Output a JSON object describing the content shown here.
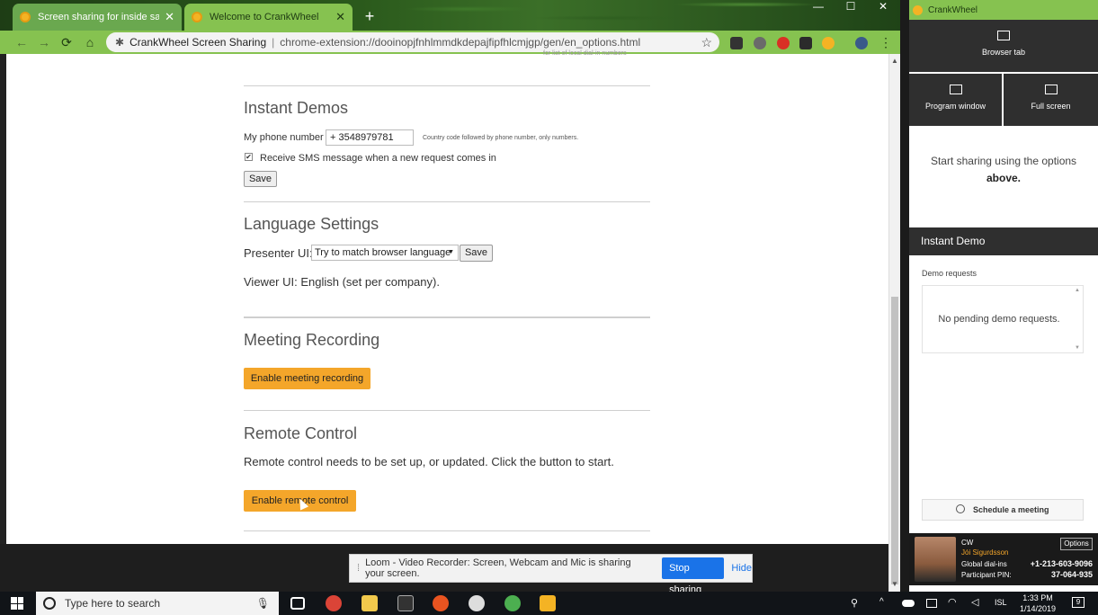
{
  "browser": {
    "tabs": [
      {
        "title": "Screen sharing for inside sales an",
        "close": "✕"
      },
      {
        "title": "Welcome to CrankWheel",
        "close": "✕"
      }
    ],
    "new_tab": "+",
    "window_controls": [
      "—",
      "☐",
      "✕"
    ],
    "nav": {
      "back": "←",
      "forward": "→",
      "reload": "⟳",
      "home": "⌂"
    },
    "omnibox": {
      "origin": "CrankWheel Screen Sharing",
      "separator": "|",
      "url": "chrome-extension://dooinopjfnhlmmdkdepajfipfhlcmjgp/gen/en_options.html",
      "star": "☆"
    },
    "menu": "⋮"
  },
  "page": {
    "top_fragment": "for list of local dial-in numbers",
    "instant_demos": {
      "title": "Instant Demos",
      "phone_label": "My phone number",
      "phone_value": "+  3548979781",
      "phone_hint": "Country code followed by phone number, only numbers.",
      "sms_label": "Receive SMS message when a new request comes in",
      "sms_checked": "✔",
      "save": "Save"
    },
    "language": {
      "title": "Language Settings",
      "presenter_label": "Presenter UI:",
      "presenter_value": "Try to match browser language",
      "select_arrow": "▼",
      "save": "Save",
      "viewer_text": "Viewer UI: English (set per company)."
    },
    "recording": {
      "title": "Meeting Recording",
      "button": "Enable meeting recording"
    },
    "remote": {
      "title": "Remote Control",
      "text": "Remote control needs to be set up, or updated. Click the button to start.",
      "button": "Enable remote control"
    }
  },
  "loom": {
    "grip": "⁞",
    "message": "Loom - Video Recorder: Screen, Webcam and Mic is sharing your screen.",
    "stop": "Stop sharing",
    "hide": "Hide"
  },
  "crankwheel": {
    "title": "CrankWheel",
    "tiles": {
      "browser_tab": "Browser tab",
      "program_window": "Program window",
      "full_screen": "Full screen"
    },
    "start_text": "Start sharing using the options",
    "start_bold": "above.",
    "instant_demo": "Instant Demo",
    "demo_requests_label": "Demo requests",
    "no_requests": "No pending demo requests.",
    "scroll_up": "▲",
    "scroll_down": "▼",
    "schedule": "Schedule a meeting",
    "schedule_icon": "clock-icon",
    "card": {
      "company": "CW",
      "name": "Jói Sigurdsson",
      "dialin_label": "Global dial-ins",
      "dialin_value": "+1-213-603-9096",
      "pin_label": "Participant PIN:",
      "pin_value": "37-064-935",
      "options": "Options"
    }
  },
  "taskbar": {
    "search_placeholder": "Type here to search",
    "language": "ISL",
    "time": "1:33 PM",
    "date": "1/14/2019",
    "notifications": "9"
  },
  "colors": {
    "accent_green": "#86c250",
    "orange_button": "#f4a62a",
    "loom_blue": "#1a73e8",
    "dark_panel": "#2f2f2f"
  }
}
